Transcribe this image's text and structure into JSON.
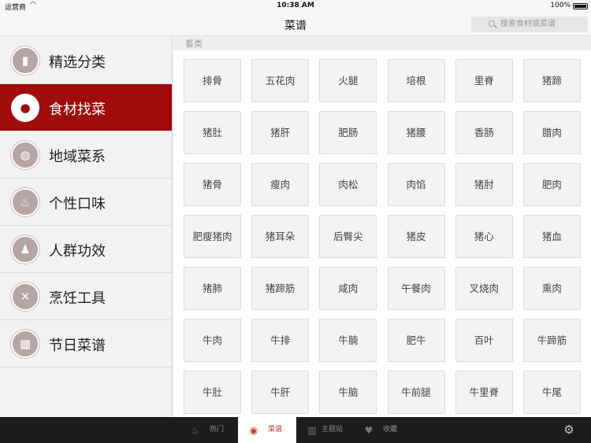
{
  "status": {
    "carrier": "运营商",
    "time": "10:38 AM",
    "battery": "100%"
  },
  "nav": {
    "title": "菜谱",
    "search_placeholder": "搜索食材或菜谱"
  },
  "sidebar": {
    "items": [
      {
        "label": "精选分类",
        "icon": "book-icon",
        "glyph": "▮",
        "active": false
      },
      {
        "label": "食材找菜",
        "icon": "mushroom-icon",
        "glyph": "●",
        "active": true
      },
      {
        "label": "地域菜系",
        "icon": "globe-icon",
        "glyph": "◍",
        "active": false
      },
      {
        "label": "个性口味",
        "icon": "pepper-icon",
        "glyph": "♨",
        "active": false
      },
      {
        "label": "人群功效",
        "icon": "people-icon",
        "glyph": "♟",
        "active": false
      },
      {
        "label": "烹饪工具",
        "icon": "utensils-icon",
        "glyph": "✕",
        "active": false
      },
      {
        "label": "节日菜谱",
        "icon": "calendar-icon",
        "glyph": "▦",
        "active": false
      }
    ]
  },
  "main": {
    "section_title": "畜类",
    "items": [
      "排骨",
      "五花肉",
      "火腿",
      "培根",
      "里脊",
      "猪蹄",
      "猪肚",
      "猪肝",
      "肥肠",
      "猪腰",
      "香肠",
      "腊肉",
      "猪骨",
      "瘦肉",
      "肉松",
      "肉馅",
      "猪肘",
      "肥肉",
      "肥瘦猪肉",
      "猪耳朵",
      "后臀尖",
      "猪皮",
      "猪心",
      "猪血",
      "猪肺",
      "猪蹄筋",
      "咸肉",
      "午餐肉",
      "叉烧肉",
      "熏肉",
      "牛肉",
      "牛排",
      "牛腩",
      "肥牛",
      "百叶",
      "牛蹄筋",
      "牛肚",
      "牛肝",
      "牛脑",
      "牛前腿",
      "牛里脊",
      "牛尾"
    ]
  },
  "tabbar": {
    "tabs": [
      {
        "label": "热门",
        "icon": "flame-icon",
        "glyph": "♨",
        "active": false
      },
      {
        "label": "菜谱",
        "icon": "pot-icon",
        "glyph": "◉",
        "active": true
      },
      {
        "label": "主题站",
        "icon": "open-book-icon",
        "glyph": "▥",
        "active": false
      },
      {
        "label": "收藏",
        "icon": "heart-icon",
        "glyph": "♥",
        "active": false
      }
    ],
    "settings_icon": "gear-icon"
  },
  "colors": {
    "accent": "#a00b0b",
    "tab_active_text": "#c0392b",
    "tabbar_bg": "#1c1c1c"
  }
}
